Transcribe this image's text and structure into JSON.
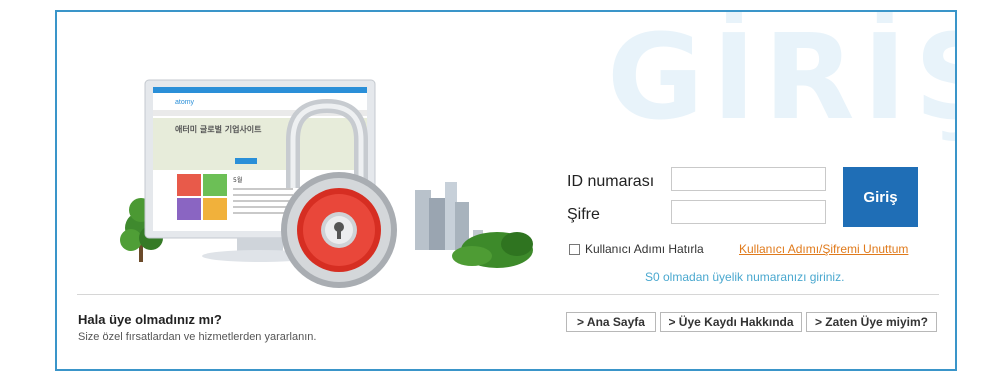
{
  "watermark": "GİRİŞ",
  "login": {
    "id_label": "ID numarası",
    "password_label": "Şifre",
    "id_value": "",
    "password_value": "",
    "submit_label": "Giriş",
    "remember_label": "Kullanıcı Adımı Hatırla",
    "forgot_link": "Kullanıcı Adımı/Şifremi Unuttum",
    "hint": "S0 olmadan üyelik numaranızı giriniz."
  },
  "signup": {
    "title": "Hala üye olmadınız mı?",
    "subtitle": "Size özel fırsatlardan ve hizmetlerden yararlanın."
  },
  "nav_buttons": [
    "> Ana Sayfa",
    "> Üye Kaydı Hakkında",
    "> Zaten Üye miyim?"
  ],
  "illustration": {
    "screen_logo": "atomy",
    "screen_banner": "애터미 글로벌 기업사이트",
    "calendar_label": "5월"
  },
  "colors": {
    "accent": "#1f6eb6",
    "border": "#3a95c9",
    "link_orange": "#e07a1b",
    "hint_blue": "#4aa8cf"
  },
  "icons": [
    "eye-icon",
    "padlock-icon",
    "checkbox"
  ]
}
